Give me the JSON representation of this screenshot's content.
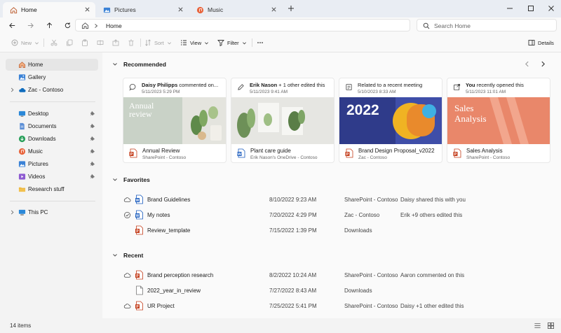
{
  "tabs": [
    {
      "label": "Home",
      "icon": "home-icon"
    },
    {
      "label": "Pictures",
      "icon": "pictures-folder-icon"
    },
    {
      "label": "Music",
      "icon": "music-icon"
    }
  ],
  "address": {
    "path": "Home"
  },
  "search": {
    "placeholder": "Search Home"
  },
  "toolbar": {
    "new_label": "New",
    "sort_label": "Sort",
    "view_label": "View",
    "filter_label": "Filter",
    "details_label": "Details"
  },
  "sidebar": {
    "items": [
      {
        "label": "Home"
      },
      {
        "label": "Gallery"
      },
      {
        "label": "Zac - Contoso"
      },
      {
        "label": "Desktop"
      },
      {
        "label": "Documents"
      },
      {
        "label": "Downloads"
      },
      {
        "label": "Music"
      },
      {
        "label": "Pictures"
      },
      {
        "label": "Videos"
      },
      {
        "label": "Research stuff"
      },
      {
        "label": "This PC"
      }
    ]
  },
  "recommended": {
    "title": "Recommended",
    "cards": [
      {
        "actor": "Daisy Philipps",
        "activity": " commented on...",
        "date": "5/11/2023 5:29 PM",
        "thumb_title": "Annual review",
        "name": "Annual Review",
        "location": "SharePoint - Contoso"
      },
      {
        "actor": "Erik Nason",
        "activity": " + 1 other edited this",
        "date": "5/11/2023 9:41 AM",
        "name": "Plant care guide",
        "location": "Erik Nason's OneDrive - Contoso"
      },
      {
        "actor": "",
        "activity": "Related to a recent meeting",
        "date": "5/10/2023 8:33 AM",
        "thumb_title": "2022",
        "name": "Brand Design Proposal_v2022",
        "location": "Zac - Contoso"
      },
      {
        "actor": "You",
        "activity": " recently opened this",
        "date": "5/11/2023 11:01 AM",
        "thumb_title": "Sales Analysis",
        "name": "Sales Analysis",
        "location": "SharePoint - Contoso"
      }
    ]
  },
  "favorites": {
    "title": "Favorites",
    "rows": [
      {
        "name": "Brand Guidelines",
        "date": "8/10/2022 9:23 AM",
        "location": "SharePoint - Contoso",
        "activity": "Daisy shared this with you"
      },
      {
        "name": "My notes",
        "date": "7/20/2022 4:29 PM",
        "location": "Zac - Contoso",
        "activity": "Erik +9 others edited this"
      },
      {
        "name": "Review_template",
        "date": "7/15/2022 1:39 PM",
        "location": "Downloads",
        "activity": ""
      }
    ]
  },
  "recent": {
    "title": "Recent",
    "rows": [
      {
        "name": "Brand perception research",
        "date": "8/2/2022 10:24 AM",
        "location": "SharePoint - Contoso",
        "activity": "Aaron commented on this"
      },
      {
        "name": "2022_year_in_review",
        "date": "7/27/2022 8:43 AM",
        "location": "Downloads",
        "activity": ""
      },
      {
        "name": "UR Project",
        "date": "7/25/2022 5:41 PM",
        "location": "SharePoint - Contoso",
        "activity": "Daisy +1 other edited this"
      }
    ]
  },
  "status": {
    "item_count": "14 items"
  },
  "colors": {
    "accent": "#0067c0",
    "pdf_red": "#c43e1c",
    "word_blue": "#185abd"
  }
}
